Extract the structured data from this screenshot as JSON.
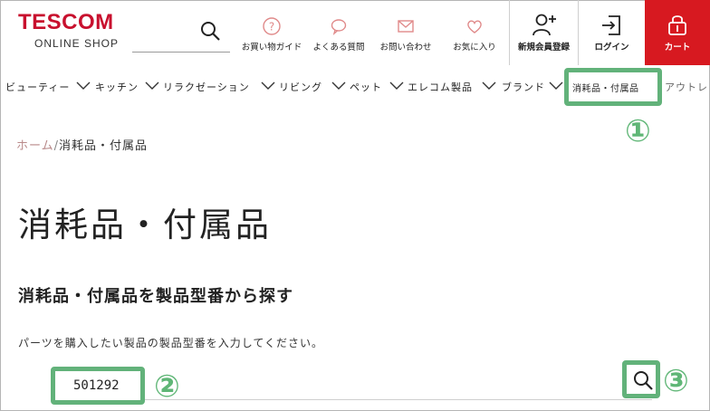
{
  "brand": {
    "name": "TESCOM",
    "sub": "ONLINE SHOP",
    "color": "#c8102e"
  },
  "header": {
    "links": [
      {
        "label": "お買い物ガイド",
        "icon": "question-circle-icon"
      },
      {
        "label": "よくある質問",
        "icon": "chat-bubble-icon"
      },
      {
        "label": "お問い合わせ",
        "icon": "mail-icon"
      },
      {
        "label": "お気に入り",
        "icon": "heart-icon"
      }
    ],
    "register": {
      "label": "新規会員登録",
      "icon": "user-plus-icon"
    },
    "login": {
      "label": "ログイン",
      "icon": "login-icon"
    },
    "cart": {
      "label": "カート",
      "icon": "cart-icon",
      "color": "#d71920"
    }
  },
  "categories": [
    "ビューティー",
    "キッチン",
    "リラクゼーション",
    "リビング",
    "ペット",
    "エレコム製品",
    "ブランド",
    "消耗品・付属品",
    "アウトレ"
  ],
  "breadcrumb": {
    "home": "ホーム",
    "separator": "/",
    "current": "消耗品・付属品"
  },
  "page": {
    "title": "消耗品・付属品",
    "section_title": "消耗品・付属品を製品型番から探す",
    "instruction": "パーツを購入したい製品の製品型番を入力してください。",
    "model_value": "501292"
  },
  "markers": [
    "①",
    "②",
    "③"
  ],
  "highlight_color": "#62b27a"
}
